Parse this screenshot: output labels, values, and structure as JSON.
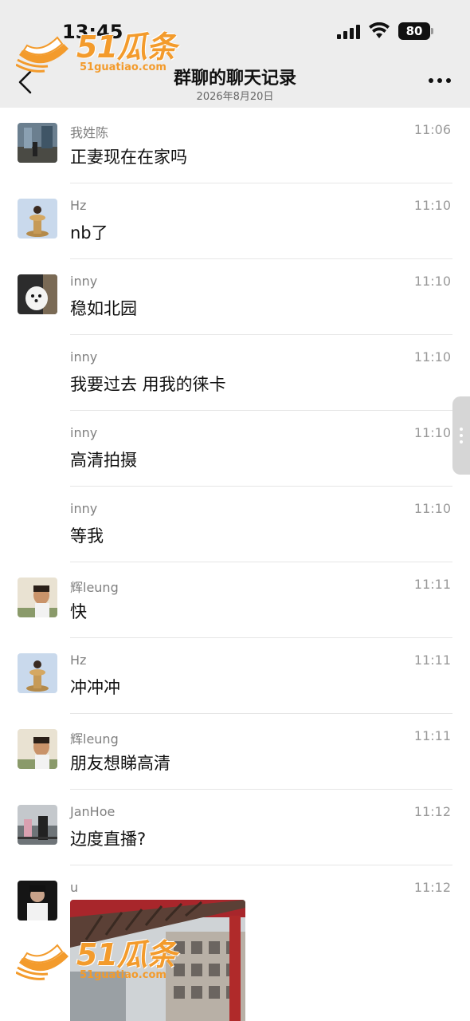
{
  "status_bar": {
    "time": "13:45",
    "battery": "80"
  },
  "nav": {
    "title": "群聊的聊天记录",
    "subtitle": "2026年8月20日"
  },
  "watermark": {
    "brand": "51瓜条",
    "domain": "51guatiao.com",
    "color": "#f39b2c"
  },
  "messages": [
    {
      "sender": "我姓陈",
      "time": "11:06",
      "text": "正妻现在在家吗",
      "avatar": "street-photo"
    },
    {
      "sender": "Hz",
      "time": "11:10",
      "text": "nb了",
      "avatar": "figurine"
    },
    {
      "sender": "inny",
      "time": "11:10",
      "text": "稳如北园",
      "avatar": "white-dog"
    },
    {
      "sender": "inny",
      "time": "11:10",
      "text": "我要过去 用我的徕卡",
      "avatar": ""
    },
    {
      "sender": "inny",
      "time": "11:10",
      "text": "高清拍摄",
      "avatar": ""
    },
    {
      "sender": "inny",
      "time": "11:10",
      "text": "等我",
      "avatar": ""
    },
    {
      "sender": "辉leung",
      "time": "11:11",
      "text": "快",
      "avatar": "man-portrait"
    },
    {
      "sender": "Hz",
      "time": "11:11",
      "text": "冲冲冲",
      "avatar": "figurine"
    },
    {
      "sender": "辉leung",
      "time": "11:11",
      "text": "朋友想睇高清",
      "avatar": "man-portrait"
    },
    {
      "sender": "JanHoe",
      "time": "11:12",
      "text": "边度直播?",
      "avatar": "people-photo"
    },
    {
      "sender": "u",
      "time": "11:12",
      "text": "",
      "avatar": "dark-photo"
    }
  ],
  "colors": {
    "header_bg": "#ededed",
    "divider": "#e6e6e6",
    "accent": "#f39b2c"
  }
}
